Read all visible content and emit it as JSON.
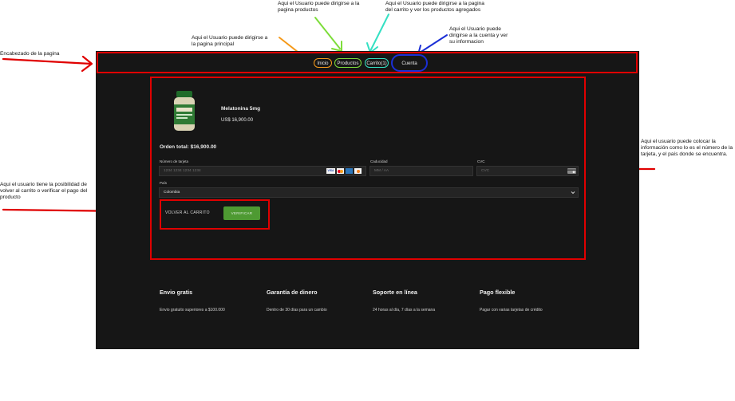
{
  "annotations": {
    "header": "Encabezado de la pagina",
    "home": "Aqui el Usuario puede dirigirse a la pagina principal",
    "products": "Aqui el Usuario puede dirigirse a la pagina productos",
    "cart": "Aqui el Usuario puede dirigirse a la pagina del carrito y ver los productos agregados",
    "account": "Aqui el Usuario puede dirigirse a la cuenta y ver su informacion",
    "card_info": "Aqui el usuario puede colocar la información como lo es el número de la tarjeta, y el país donde se encuentra.",
    "actions": "Aqui el usuario tiene la posibilidad de volver al carrito o verificar el pago del producto"
  },
  "nav": {
    "inicio": "Inicio",
    "productos": "Productos",
    "carrito": "Carrito(1)",
    "cuenta": "Cuenta"
  },
  "product": {
    "name": "Melatonina 5mg",
    "price": "US$ 16,900.00"
  },
  "order": {
    "total": "Orden total: $16,900.00"
  },
  "form": {
    "card_label": "Número de tarjeta",
    "card_placeholder": "1234 1234 1234 1234",
    "expiry_label": "Caducidad",
    "expiry_placeholder": "MM / AA",
    "cvc_label": "CVC",
    "cvc_placeholder": "CVC",
    "country_label": "País",
    "country_value": "Colombia",
    "card_brands": [
      "VISA",
      "MC",
      "AMEX",
      "DISC"
    ]
  },
  "actions": {
    "back": "VOLVER AL CARRITO",
    "verify": "VERIFICAR"
  },
  "features": [
    {
      "title": "Envio gratis",
      "text": "Envio gratuito superiores a $100.000"
    },
    {
      "title": "Garantía de dinero",
      "text": "Dentro de 30 días para un cambio"
    },
    {
      "title": "Soporte en línea",
      "text": "24 horas al día, 7 días a la semana"
    },
    {
      "title": "Pago flexible",
      "text": "Pagar con varias tarjetas de crédito"
    }
  ],
  "colors": {
    "annotation_red": "#e00000",
    "page_bg": "#161616",
    "verify_green": "#4e9a32"
  }
}
